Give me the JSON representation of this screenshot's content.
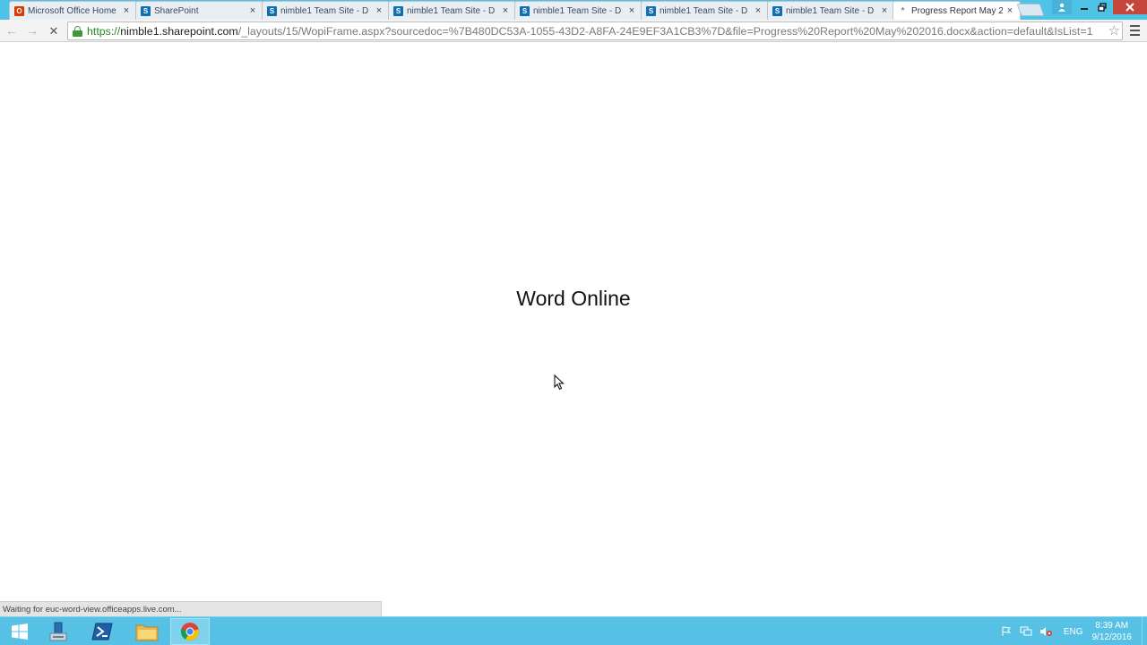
{
  "tabs": [
    {
      "label": "Microsoft Office Home",
      "icon": "office-icon"
    },
    {
      "label": "SharePoint",
      "icon": "sharepoint-icon"
    },
    {
      "label": "nimble1 Team Site - D",
      "icon": "sharepoint-icon"
    },
    {
      "label": "nimble1 Team Site - D",
      "icon": "sharepoint-icon"
    },
    {
      "label": "nimble1 Team Site - D",
      "icon": "sharepoint-icon"
    },
    {
      "label": "nimble1 Team Site - D",
      "icon": "sharepoint-icon"
    },
    {
      "label": "nimble1 Team Site - D",
      "icon": "sharepoint-icon"
    },
    {
      "label": "Progress Report May 2",
      "icon": "loading-icon",
      "active": true
    }
  ],
  "address_bar": {
    "scheme": "https://",
    "host": "nimble1.sharepoint.com",
    "path": "/_layouts/15/WopiFrame.aspx?sourcedoc=%7B480DC53A-1055-43D2-A8FA-24E9EF3A1CB3%7D&file=Progress%20Report%20May%202016.docx&action=default&IsList=1"
  },
  "page": {
    "loading_title": "Word Online"
  },
  "status_bubble": "Waiting for euc-word-view.officeapps.live.com...",
  "taskbar": {
    "items": [
      "start-icon",
      "server-manager-icon",
      "powershell-icon",
      "file-explorer-icon",
      "chrome-icon"
    ],
    "language": "ENG",
    "time": "8:39 AM",
    "date": "9/12/2016"
  },
  "colors": {
    "tabstrip": "#4fc3e6",
    "taskbar": "#56c1e5",
    "secure_green": "#2a8a2a"
  }
}
